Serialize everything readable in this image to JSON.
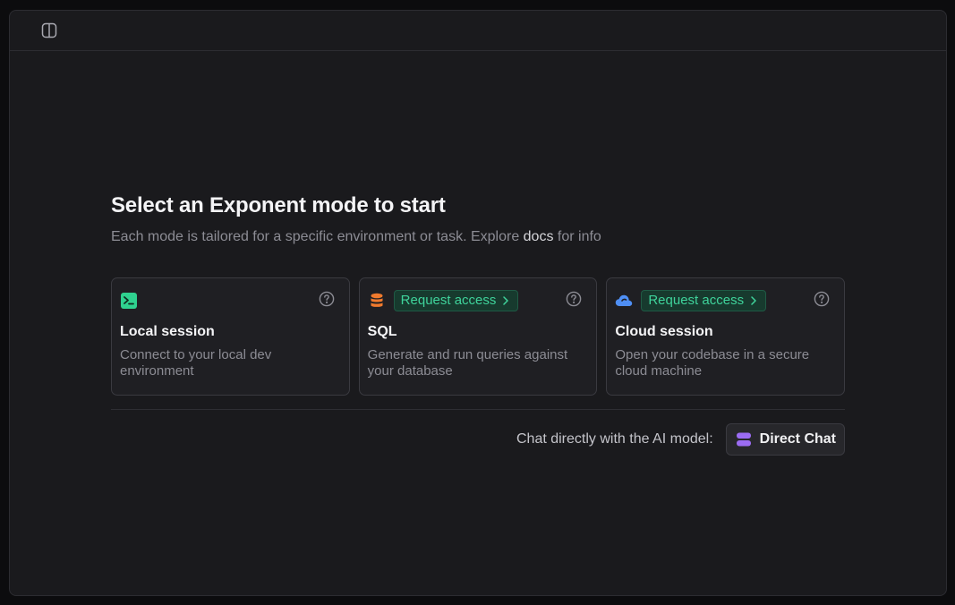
{
  "header": {
    "toggle_icon": "sidebar-toggle-icon"
  },
  "main": {
    "title": "Select an Exponent mode to start",
    "subtitle_before": "Each mode is tailored for a specific environment or task. Explore ",
    "subtitle_link": "docs",
    "subtitle_after": " for info"
  },
  "modes": [
    {
      "title": "Local session",
      "description": "Connect to your local dev environment",
      "icon": "terminal-icon",
      "icon_color": "#2fd18f",
      "access_label": ""
    },
    {
      "title": "SQL",
      "description": "Generate and run queries against your database",
      "icon": "database-icon",
      "icon_color": "#f07a2e",
      "access_label": "Request access"
    },
    {
      "title": "Cloud session",
      "description": "Open your codebase in a secure cloud machine",
      "icon": "cloud-icon",
      "icon_color": "#4f8ff5",
      "access_label": "Request access"
    }
  ],
  "direct_chat": {
    "label": "Chat directly with the AI model:",
    "button": "Direct Chat",
    "icon_color": "#9b6cf2"
  },
  "colors": {
    "accent_green": "#3fd39b",
    "background": "#1a1a1d"
  }
}
